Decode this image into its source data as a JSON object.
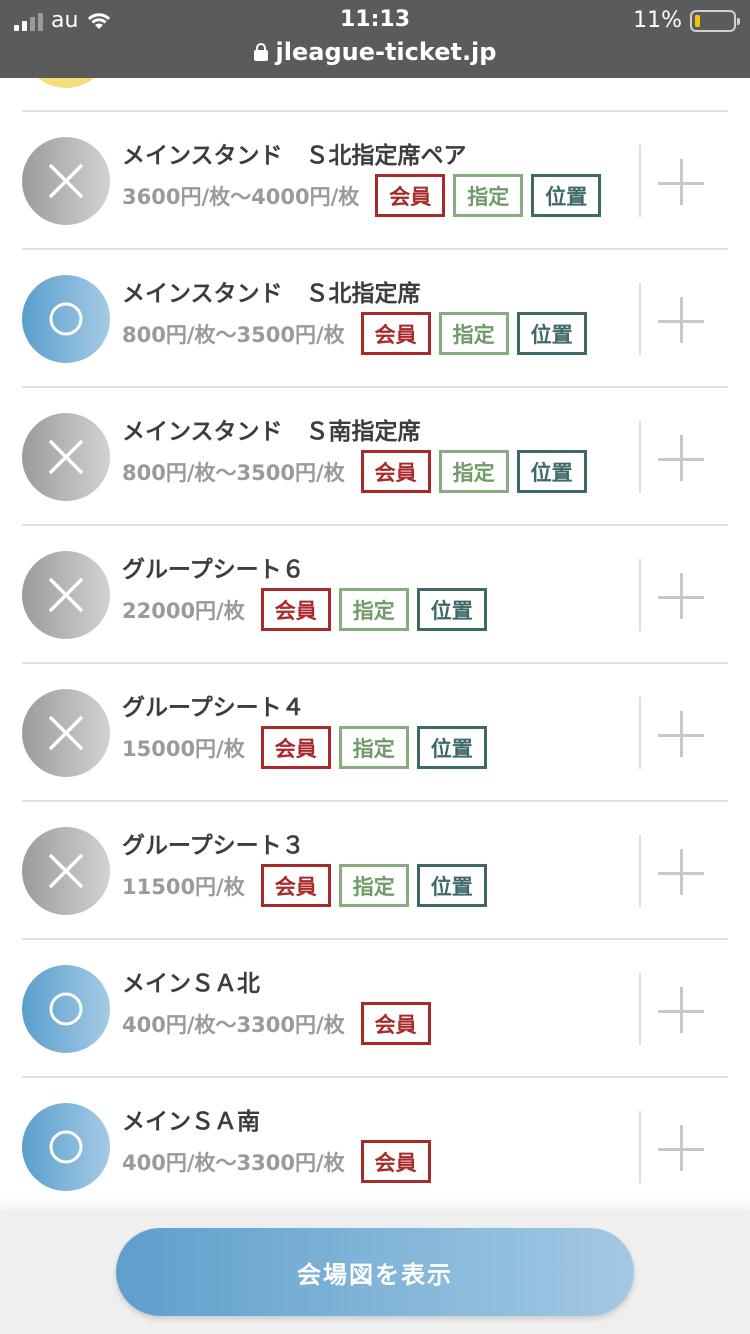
{
  "status_bar": {
    "carrier": "au",
    "time": "11:13",
    "battery": "11%",
    "url": "jleague-ticket.jp"
  },
  "seats": [
    {
      "name": "メインスタンド　Ｓ北指定席ペア",
      "price": "3600円/枚〜4000円/枚",
      "status": "unavailable",
      "tags": [
        "会員",
        "指定",
        "位置"
      ]
    },
    {
      "name": "メインスタンド　Ｓ北指定席",
      "price": "800円/枚〜3500円/枚",
      "status": "available",
      "tags": [
        "会員",
        "指定",
        "位置"
      ]
    },
    {
      "name": "メインスタンド　Ｓ南指定席",
      "price": "800円/枚〜3500円/枚",
      "status": "unavailable",
      "tags": [
        "会員",
        "指定",
        "位置"
      ]
    },
    {
      "name": "グループシート６",
      "price": "22000円/枚",
      "status": "unavailable",
      "tags": [
        "会員",
        "指定",
        "位置"
      ]
    },
    {
      "name": "グループシート４",
      "price": "15000円/枚",
      "status": "unavailable",
      "tags": [
        "会員",
        "指定",
        "位置"
      ]
    },
    {
      "name": "グループシート３",
      "price": "11500円/枚",
      "status": "unavailable",
      "tags": [
        "会員",
        "指定",
        "位置"
      ]
    },
    {
      "name": "メインＳＡ北",
      "price": "400円/枚〜3300円/枚",
      "status": "available",
      "tags": [
        "会員"
      ]
    },
    {
      "name": "メインＳＡ南",
      "price": "400円/枚〜3300円/枚",
      "status": "available",
      "tags": [
        "会員"
      ]
    }
  ],
  "bottom": {
    "map_button": "会場図を表示"
  },
  "icons": {
    "unavailable": "cross-icon",
    "available": "circle-icon",
    "add": "plus-icon"
  },
  "colors": {
    "member_tag": "#a82a2a",
    "reserved_tag": "#6f9c67",
    "position_tag": "#3f6868",
    "available": "#5a9fcc",
    "unavailable": "#9b9b9b"
  }
}
